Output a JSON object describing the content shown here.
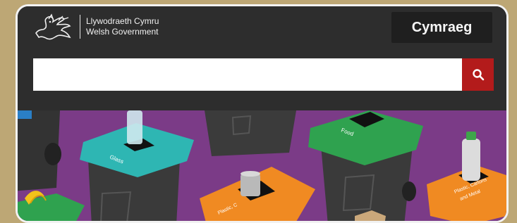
{
  "header": {
    "logo_line1": "Llywodraeth Cymru",
    "logo_line2": "Welsh Government",
    "language_button": "Cymraeg"
  },
  "search": {
    "value": "",
    "button_icon": "search-icon"
  },
  "hero": {
    "bin_labels": [
      "Glass",
      "Food",
      "Plastic, Cans",
      "Plastic, Cartons and Metal"
    ]
  },
  "colors": {
    "header_bg": "#2d2d2d",
    "search_button": "#b31b1b",
    "hero_bg": "#7b3b87",
    "bin_body": "#3a3a3a",
    "lid_teal": "#2eb6b3",
    "lid_green": "#2fa24f",
    "lid_orange": "#f08a22",
    "page_bg": "#bda775"
  }
}
